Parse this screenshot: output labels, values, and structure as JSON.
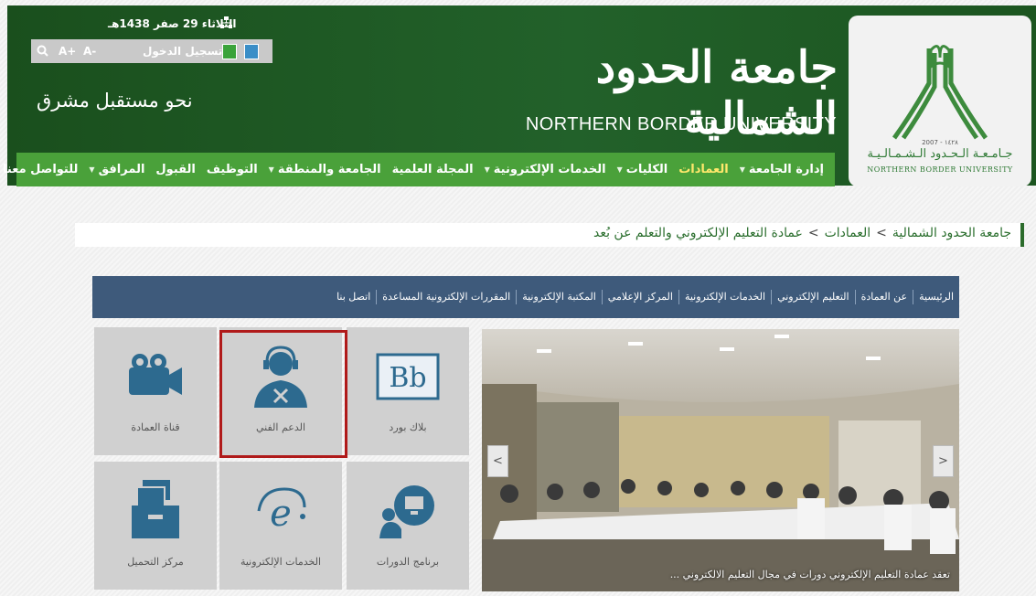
{
  "header": {
    "date": "الثلاثاء 29 صفر 1438هـ",
    "login": "تسجيل الدخول",
    "font_minus": "A-",
    "font_plus": "A+",
    "tagline": "نحو مستقبل مشرق",
    "university_ar": "جامعة الحدود الشمالية",
    "university_en": "NORTHERN BORDER UNIVERSITY",
    "logo_ar": "جـامـعـة الـحـدود الـشـمـالـيـة",
    "logo_en": "NORTHERN BORDER UNIVERSITY",
    "logo_year": "2007 - ١٤٢٨"
  },
  "nav": [
    {
      "label": "إدارة الجامعة",
      "active": false
    },
    {
      "label": "العمادات",
      "active": true
    },
    {
      "label": "الكليات",
      "active": false
    },
    {
      "label": "الخدمات الإلكترونية",
      "active": false
    },
    {
      "label": "المجلة العلمية",
      "active": false
    },
    {
      "label": "الجامعة والمنطقة",
      "active": false
    },
    {
      "label": "التوظيف",
      "active": false
    },
    {
      "label": "القبول",
      "active": false
    },
    {
      "label": "المرافق",
      "active": false
    },
    {
      "label": "للتواصل معنا",
      "active": false
    }
  ],
  "breadcrumb": {
    "home": "جامعة الحدود الشمالية",
    "section": "العمادات",
    "current": "عمادة التعليم الإلكتروني والتعلم عن بُعد",
    "separator": ">"
  },
  "subnav": [
    "الرئيسية",
    "عن العمادة",
    "التعليم الإلكتروني",
    "الخدمات الإلكترونية",
    "المركز الإعلامي",
    "المكتبة الإلكترونية",
    "المقررات الإلكترونية المساعدة",
    "اتصل بنا"
  ],
  "tiles": {
    "blackboard": "بلاك بورد",
    "support": "الدعم الفني",
    "channel": "قناة العمادة",
    "courses": "برنامج الدورات",
    "eservices": "الخدمات الإلكترونية",
    "downloads": "مركز التحميل"
  },
  "slider": {
    "caption": "تعقد عمادة التعليم الإلكتروني دورات في مجال التعليم الالكتروني ...",
    "prev": "<",
    "next": ">"
  },
  "colors": {
    "header_green": "#1e5a22",
    "nav_green": "#4aa13a",
    "active_nav": "#ffe86b",
    "subnav_blue": "#3e5a7b",
    "icon_blue": "#2d6a8f",
    "highlight_red": "#b01a1a"
  }
}
